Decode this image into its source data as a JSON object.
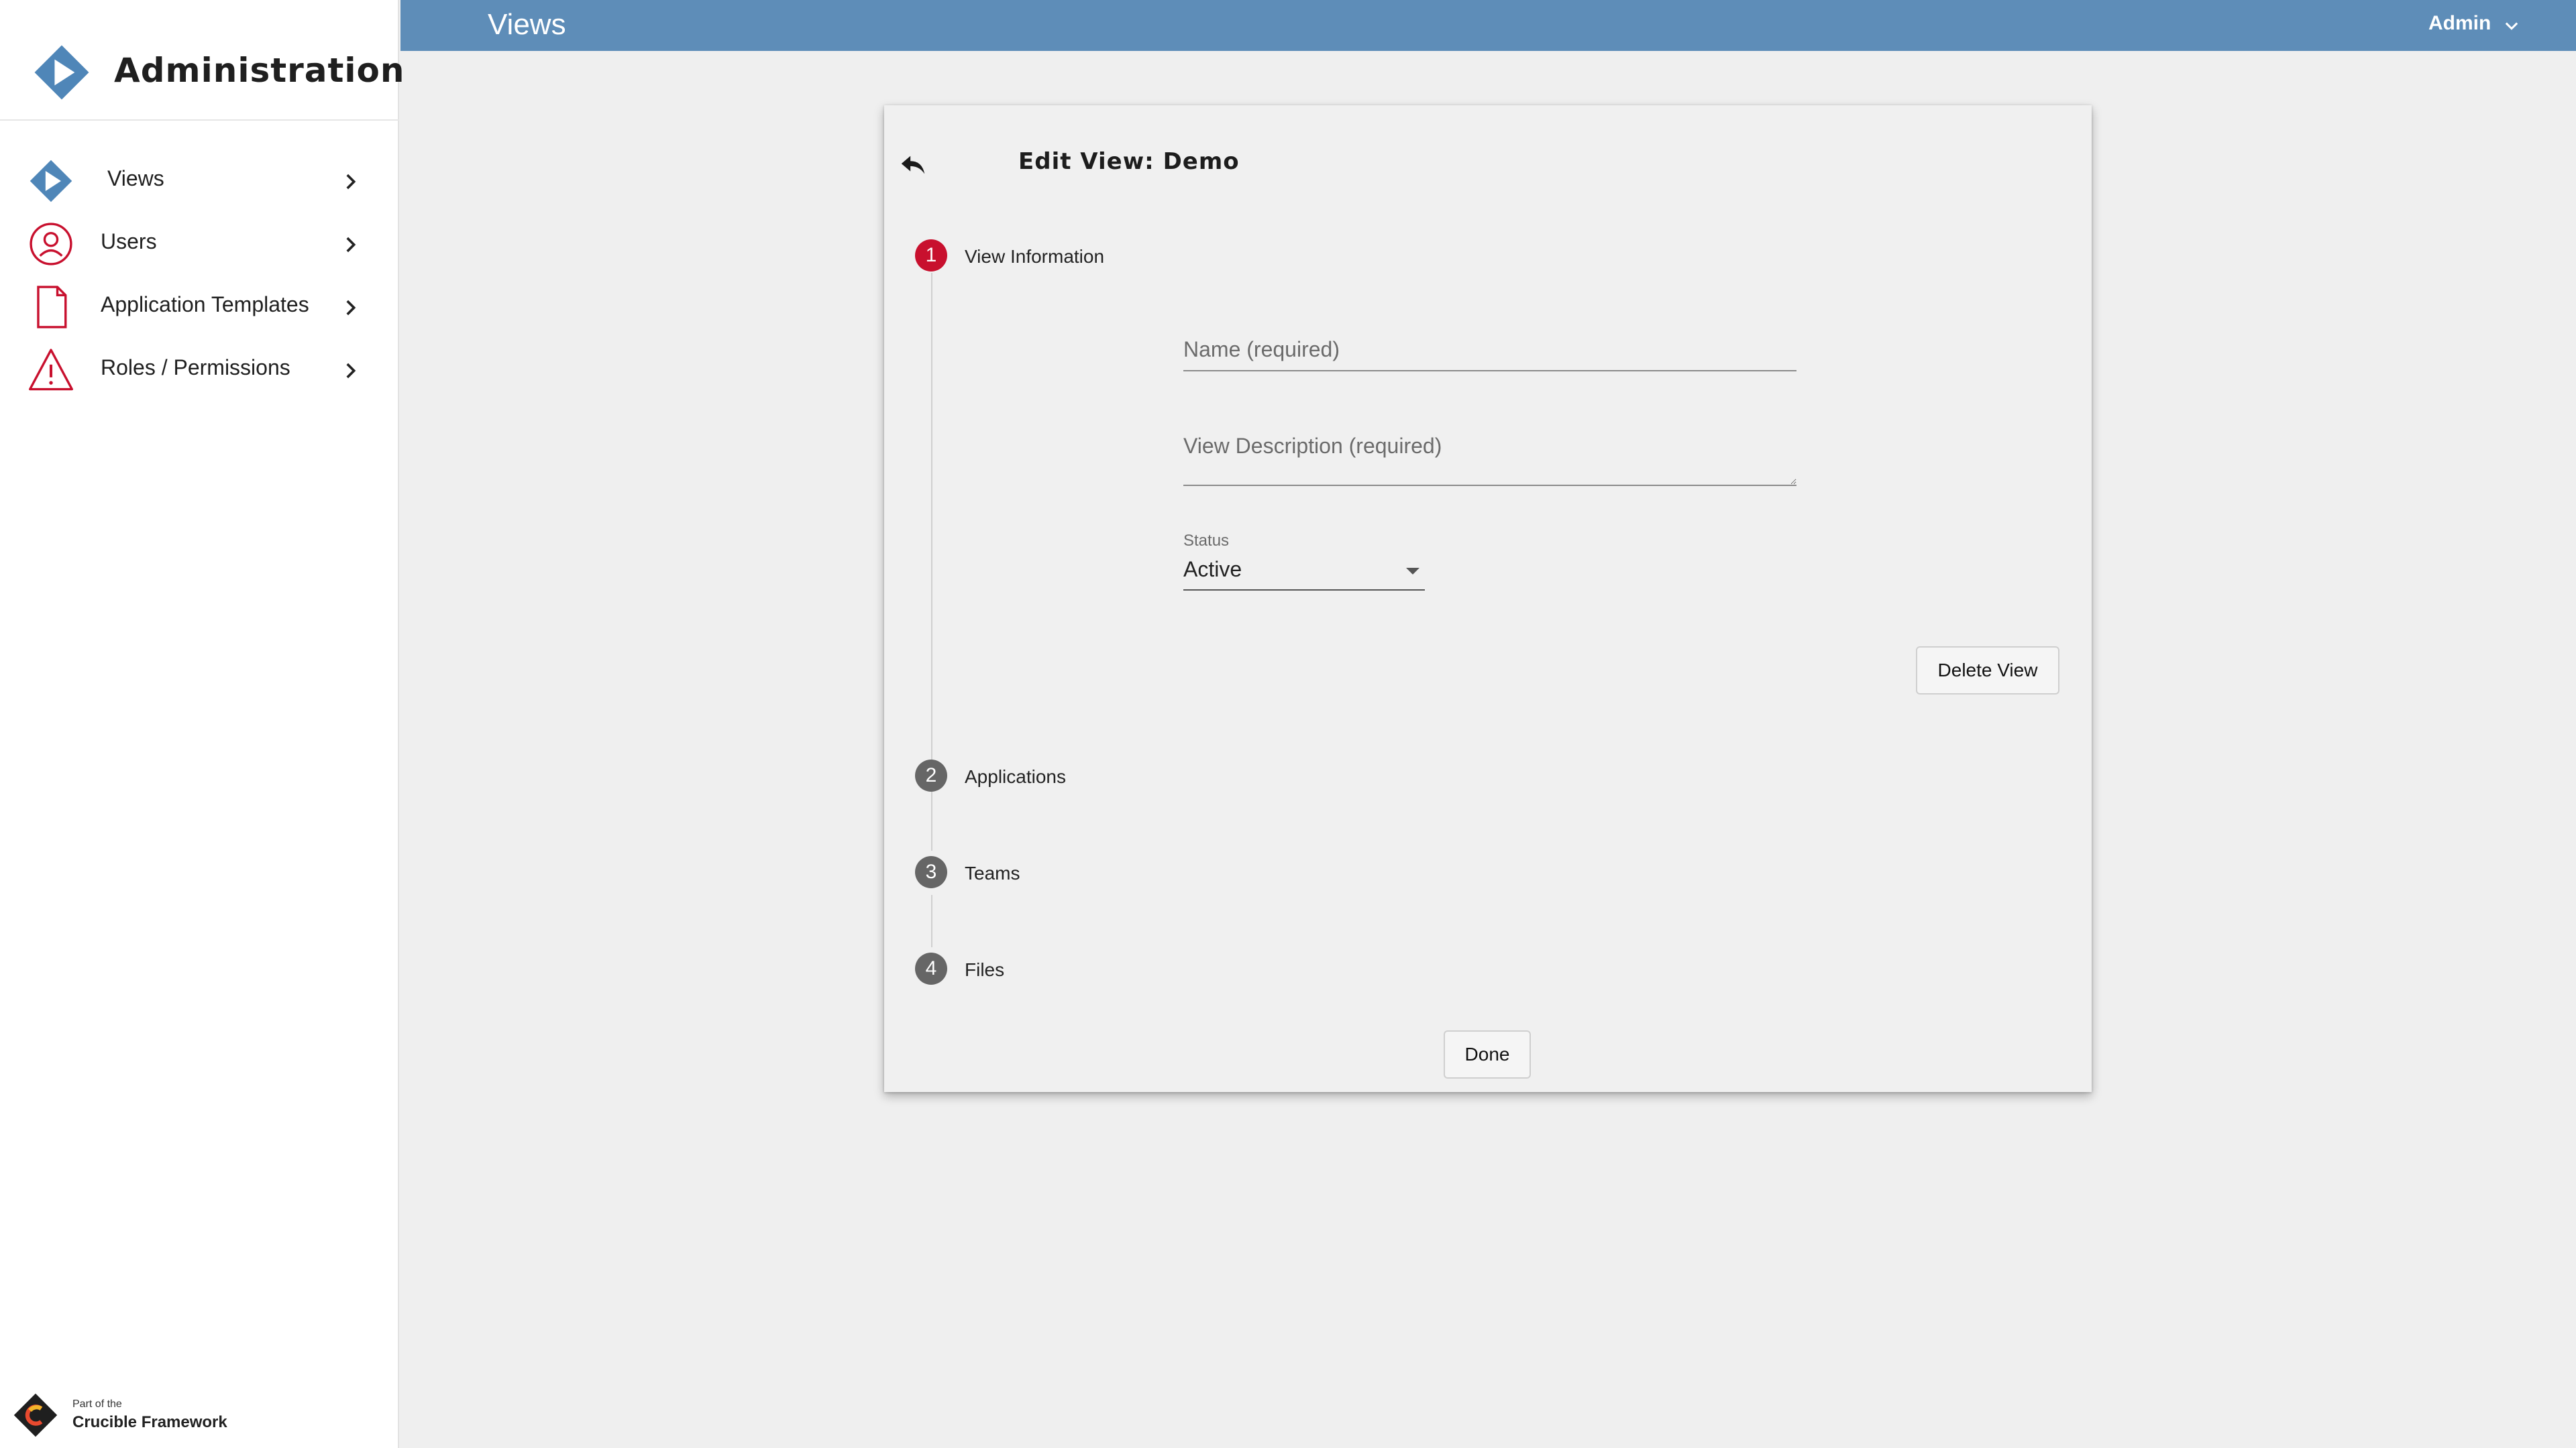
{
  "app": {
    "title": "Administration",
    "footer_small": "Part of the",
    "footer_big": "Crucible Framework"
  },
  "sidebar": {
    "items": [
      {
        "label": "Views",
        "icon": "play-diamond-icon"
      },
      {
        "label": "Users",
        "icon": "user-circle-icon"
      },
      {
        "label": "Application Templates",
        "icon": "document-icon"
      },
      {
        "label": "Roles / Permissions",
        "icon": "warning-triangle-icon"
      }
    ]
  },
  "topbar": {
    "title": "Views",
    "user_menu": "Admin"
  },
  "editor": {
    "title": "Edit View: Demo",
    "steps": [
      {
        "number": "1",
        "label": "View Information"
      },
      {
        "number": "2",
        "label": "Applications"
      },
      {
        "number": "3",
        "label": "Teams"
      },
      {
        "number": "4",
        "label": "Files"
      }
    ],
    "name_placeholder": "Name (required)",
    "name_value": "",
    "description_placeholder": "View Description (required)",
    "description_value": "",
    "status_label": "Status",
    "status_value": "Active",
    "delete_label": "Delete View",
    "done_label": "Done"
  },
  "colors": {
    "topbar": "#5e8db8",
    "brand_blue": "#4f86b8",
    "accent_red": "#c8102e",
    "step_gray": "#666666"
  }
}
